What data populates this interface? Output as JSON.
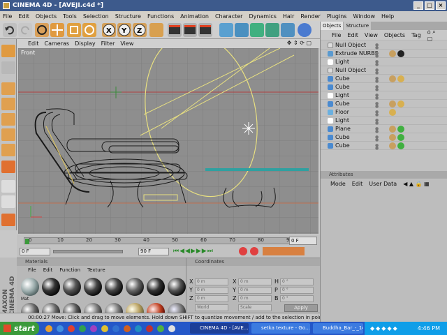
{
  "window": {
    "title": "CINEMA 4D - [AVEJI.c4d *]"
  },
  "menu": [
    "File",
    "Edit",
    "Objects",
    "Tools",
    "Selection",
    "Structure",
    "Functions",
    "Animation",
    "Character",
    "Dynamics",
    "Hair",
    "Render",
    "Plugins",
    "Window",
    "Help"
  ],
  "viewport": {
    "menu": [
      "Edit",
      "Cameras",
      "Display",
      "Filter",
      "View"
    ],
    "label": "Front"
  },
  "timeline": {
    "ticks": [
      "0",
      "10",
      "20",
      "30",
      "40",
      "50",
      "60",
      "70",
      "80",
      "90"
    ],
    "start_frame": "0 F",
    "end_frame": "90 F",
    "current_frame": "0 F"
  },
  "materials": {
    "title": "Materials",
    "menu": [
      "File",
      "Edit",
      "Function",
      "Texture"
    ],
    "labels": [
      "Mat",
      "Mat",
      "Mat",
      "Mat",
      "Mat",
      "Mat",
      "Mat",
      "Mat"
    ]
  },
  "coordinates": {
    "title": "Coordinates",
    "rows": [
      {
        "axis": "X",
        "value": "0 m",
        "rot_axis": "X",
        "rot_value": "0 m",
        "size_axis": "H",
        "size_value": "0 °"
      },
      {
        "axis": "Y",
        "value": "0 m",
        "rot_axis": "Y",
        "rot_value": "0 m",
        "size_axis": "P",
        "size_value": "0 °"
      },
      {
        "axis": "Z",
        "value": "0 m",
        "rot_axis": "Z",
        "rot_value": "0 m",
        "size_axis": "B",
        "size_value": "0 °"
      }
    ],
    "mode_select": "World",
    "scale_select": "Scale",
    "apply_label": "Apply"
  },
  "status": {
    "time": "00:00:27",
    "message": "Move: Click and drag to move elements. Hold down SHIFT to quantize movement / add to the selection in point mode, CTRL to re"
  },
  "object_manager": {
    "tabs": [
      "Objects",
      "Structure"
    ],
    "menu": [
      "File",
      "Edit",
      "View",
      "Objects",
      "Tag"
    ],
    "objects": [
      {
        "name": "Null Object",
        "type": "null",
        "tags": []
      },
      {
        "name": "Extrude NURBS",
        "type": "nurbs",
        "tags": [
          "phong",
          "material-dark"
        ]
      },
      {
        "name": "Light",
        "type": "light",
        "tags": []
      },
      {
        "name": "Null Object",
        "type": "null",
        "tags": []
      },
      {
        "name": "Cube",
        "type": "cube",
        "tags": [
          "phong",
          "material-gold"
        ]
      },
      {
        "name": "Cube",
        "type": "cube",
        "tags": []
      },
      {
        "name": "Light",
        "type": "light",
        "tags": []
      },
      {
        "name": "Cube",
        "type": "cube",
        "tags": [
          "phong",
          "material-gold"
        ]
      },
      {
        "name": "Floor",
        "type": "floor",
        "tags": [
          "material-gold"
        ]
      },
      {
        "name": "Light",
        "type": "light",
        "tags": []
      },
      {
        "name": "Plane",
        "type": "plane",
        "tags": [
          "phong",
          "material-green"
        ]
      },
      {
        "name": "Cube",
        "type": "cube",
        "tags": [
          "phong",
          "material-green"
        ]
      },
      {
        "name": "Cube",
        "type": "cube",
        "tags": [
          "phong",
          "material-green"
        ]
      }
    ]
  },
  "attributes": {
    "title": "Attributes",
    "menu": [
      "Mode",
      "Edit",
      "User Data"
    ]
  },
  "taskbar": {
    "start_label": "start",
    "tasks": [
      "CINEMA 4D - [AVE...",
      "setka texture - Go...",
      "Buddha_Bar_-_14..."
    ],
    "clock": "4:46 PM"
  },
  "brand": {
    "text": "MAXON CINEMA 4D"
  },
  "colors": {
    "title_bar": "#3d5a8c",
    "taskbar": "#2457c8",
    "start": "#3b9a3b",
    "viewport": "#8e8e8e",
    "wireframe": "#1a1a1a",
    "spline": "#e8e080"
  }
}
